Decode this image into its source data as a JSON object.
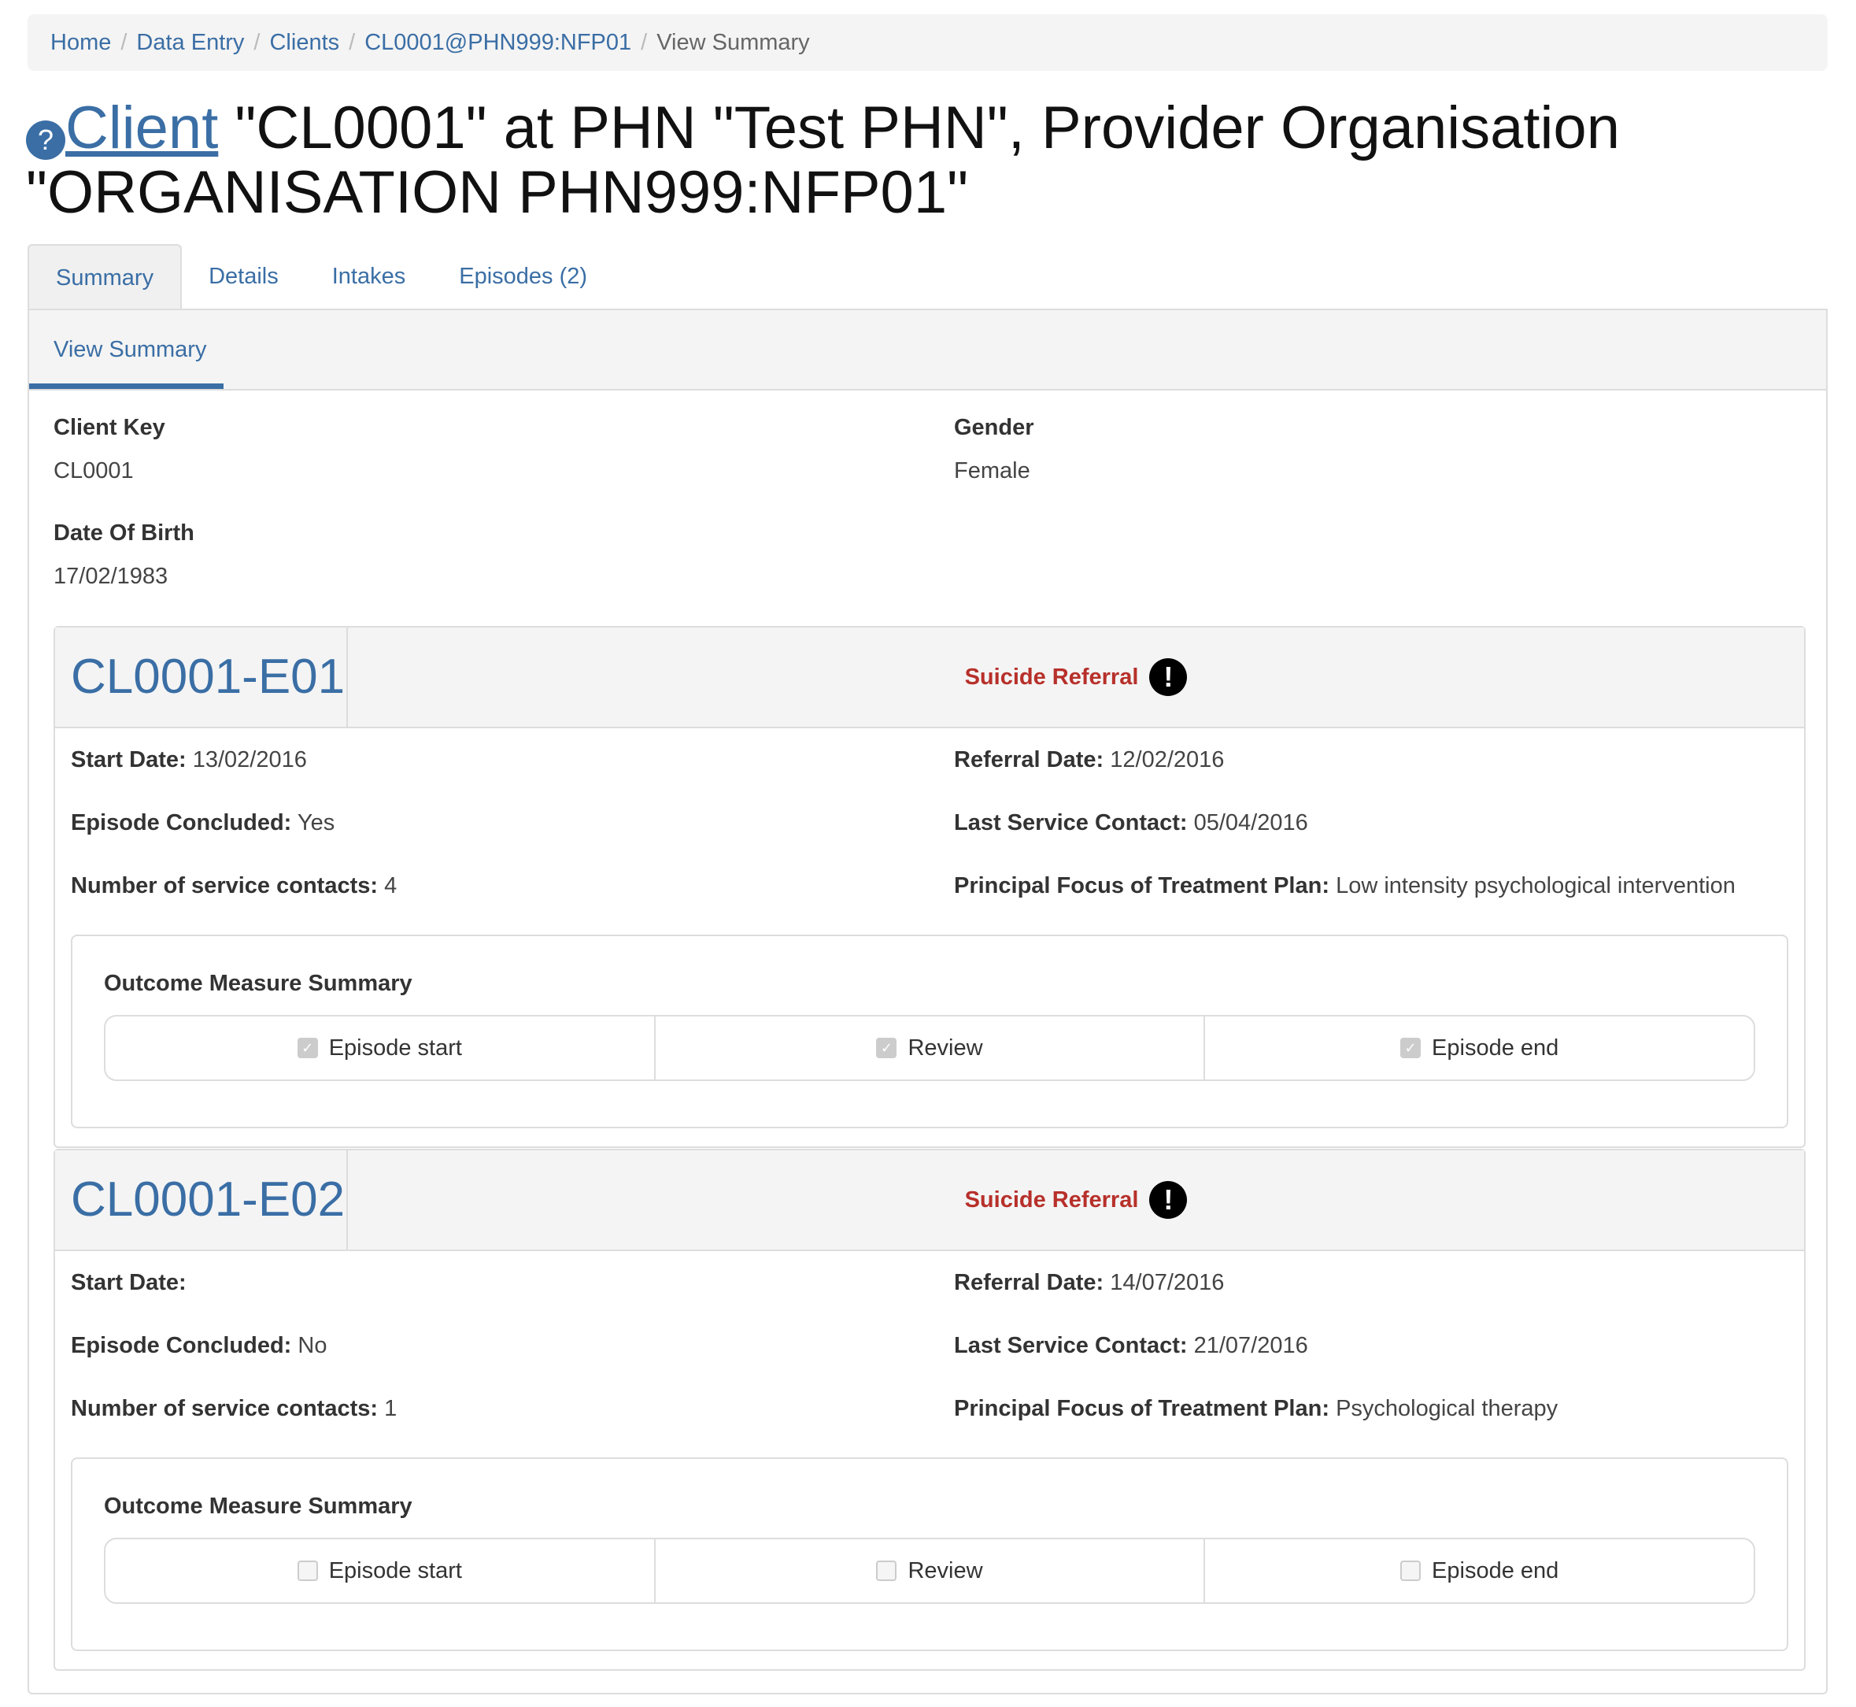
{
  "breadcrumb": [
    {
      "label": "Home",
      "link": true
    },
    {
      "label": "Data Entry",
      "link": true
    },
    {
      "label": "Clients",
      "link": true
    },
    {
      "label": "CL0001@PHN999:NFP01",
      "link": true
    },
    {
      "label": "View Summary",
      "link": false
    }
  ],
  "title": {
    "help_icon": "?",
    "link_text": "Client",
    "rest": " \"CL0001\" at PHN \"Test PHN\", Provider Organisation \"ORGANISATION PHN999:NFP01\""
  },
  "tabs": [
    {
      "label": "Summary",
      "active": true
    },
    {
      "label": "Details",
      "active": false
    },
    {
      "label": "Intakes",
      "active": false
    },
    {
      "label": "Episodes (2)",
      "active": false
    }
  ],
  "subnav": {
    "label": "View Summary"
  },
  "client": {
    "key_label": "Client Key",
    "key": "CL0001",
    "gender_label": "Gender",
    "gender": "Female",
    "dob_label": "Date Of Birth",
    "dob": "17/02/1983"
  },
  "labels": {
    "start_date": "Start Date:",
    "referral_date": "Referral Date:",
    "concluded": "Episode Concluded:",
    "last_contact": "Last Service Contact:",
    "contacts": "Number of service contacts:",
    "focus": "Principal Focus of Treatment Plan:",
    "oms_title": "Outcome Measure Summary",
    "oms_start": "Episode start",
    "oms_review": "Review",
    "oms_end": "Episode end"
  },
  "episodes": [
    {
      "key": "CL0001-E01",
      "flag": "Suicide Referral",
      "start_date": "13/02/2016",
      "referral_date": "12/02/2016",
      "concluded": "Yes",
      "last_contact": "05/04/2016",
      "contacts": "4",
      "focus": "Low intensity psychological intervention",
      "oms": {
        "start": true,
        "review": true,
        "end": true
      }
    },
    {
      "key": "CL0001-E02",
      "flag": "Suicide Referral",
      "start_date": "",
      "referral_date": "14/07/2016",
      "concluded": "No",
      "last_contact": "21/07/2016",
      "contacts": "1",
      "focus": "Psychological therapy",
      "oms": {
        "start": false,
        "review": false,
        "end": false
      }
    }
  ]
}
